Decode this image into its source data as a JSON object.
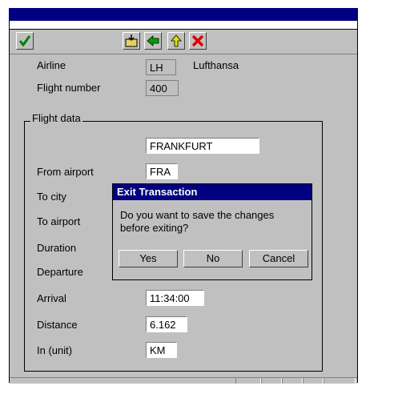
{
  "form": {
    "airline_label": "Airline",
    "airline_code": "LH",
    "airline_name": "Lufthansa",
    "flight_number_label": "Flight number",
    "flight_number": "400",
    "group_title": "Flight data",
    "from_city": "FRANKFURT",
    "from_airport_label": "From airport",
    "from_airport": "FRA",
    "to_city_label": "To city",
    "to_airport_label": "To airport",
    "duration_label": "Duration",
    "departure_label": "Departure",
    "arrival_label": "Arrival",
    "arrival": "11:34:00",
    "distance_label": "Distance",
    "distance": "6.162",
    "unit_label": "In (unit)",
    "unit": "KM"
  },
  "toolbar": {
    "icons": [
      "checkmark-icon",
      "save-folder-icon",
      "back-arrow-icon",
      "up-arrow-icon",
      "cancel-x-icon"
    ]
  },
  "dialog": {
    "title": "Exit Transaction",
    "message": "Do you want to save the changes before exiting?",
    "yes": "Yes",
    "no": "No",
    "cancel": "Cancel"
  },
  "colors": {
    "titlebar": "#000080",
    "window_bg": "#c0c0c0",
    "check": "#008000",
    "cancel_x": "#e00000",
    "arrow": "#00a000",
    "up_arrow": "#e0e000"
  }
}
